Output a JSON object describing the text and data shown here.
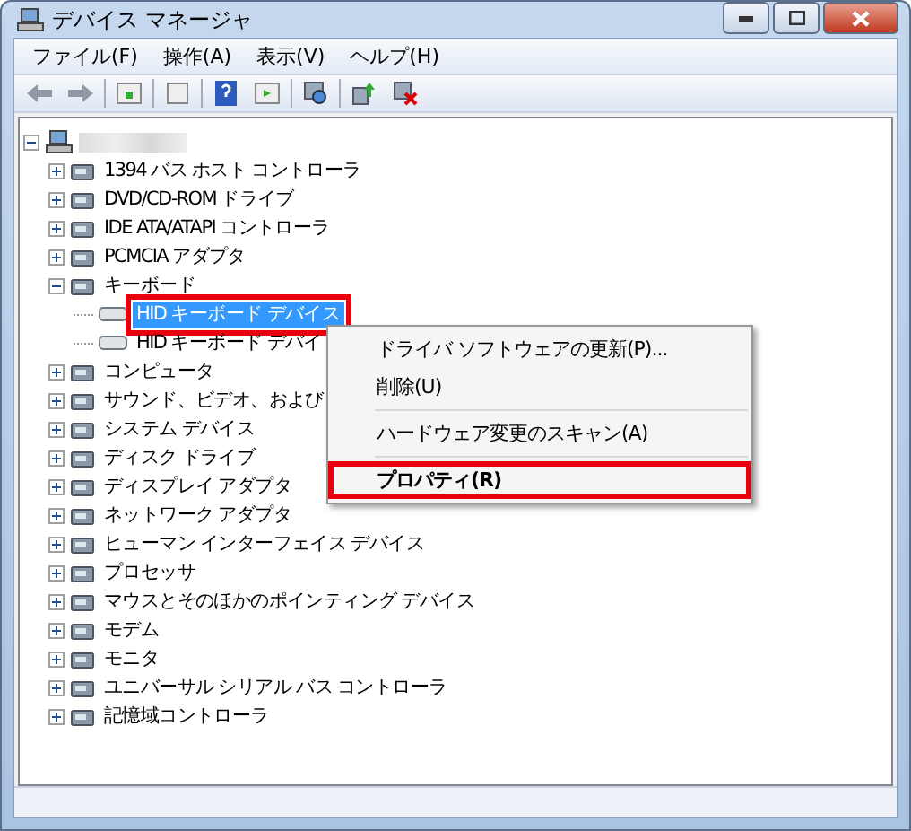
{
  "window": {
    "title": "デバイス マネージャ"
  },
  "menu_bar": [
    "ファイル(F)",
    "操作(A)",
    "表示(V)",
    "ヘルプ(H)"
  ],
  "tree": {
    "expanded": true,
    "children": [
      {
        "label": "1394 バス ホスト コントローラ",
        "expanded": false
      },
      {
        "label": "DVD/CD-ROM ドライブ",
        "expanded": false
      },
      {
        "label": "IDE ATA/ATAPI コントローラ",
        "expanded": false
      },
      {
        "label": "PCMCIA アダプタ",
        "expanded": false
      },
      {
        "label": "キーボード",
        "expanded": true,
        "children": [
          {
            "label": "HID キーボード デバイス",
            "selected": true,
            "highlighted": true
          },
          {
            "label": "HID キーボード デバイ",
            "selected": false,
            "highlighted": false
          }
        ]
      },
      {
        "label": "コンピュータ",
        "expanded": false
      },
      {
        "label": "サウンド、ビデオ、および",
        "expanded": false
      },
      {
        "label": "システム デバイス",
        "expanded": false
      },
      {
        "label": "ディスク ドライブ",
        "expanded": false
      },
      {
        "label": "ディスプレイ アダプタ",
        "expanded": false
      },
      {
        "label": "ネットワーク アダプタ",
        "expanded": false
      },
      {
        "label": "ヒューマン インターフェイス デバイス",
        "expanded": false
      },
      {
        "label": "プロセッサ",
        "expanded": false
      },
      {
        "label": "マウスとそのほかのポインティング デバイス",
        "expanded": false
      },
      {
        "label": "モデム",
        "expanded": false
      },
      {
        "label": "モニタ",
        "expanded": false
      },
      {
        "label": "ユニバーサル シリアル バス コントローラ",
        "expanded": false
      },
      {
        "label": "記憶域コントローラ",
        "expanded": false
      }
    ]
  },
  "context_menu": [
    {
      "kind": "item",
      "label": "ドライバ ソフトウェアの更新(P)...",
      "bold": false,
      "highlighted": false
    },
    {
      "kind": "item",
      "label": "削除(U)",
      "bold": false,
      "highlighted": false
    },
    {
      "kind": "separator"
    },
    {
      "kind": "item",
      "label": "ハードウェア変更のスキャン(A)",
      "bold": false,
      "highlighted": false
    },
    {
      "kind": "separator"
    },
    {
      "kind": "item",
      "label": "プロパティ(R)",
      "bold": true,
      "highlighted": true
    }
  ]
}
